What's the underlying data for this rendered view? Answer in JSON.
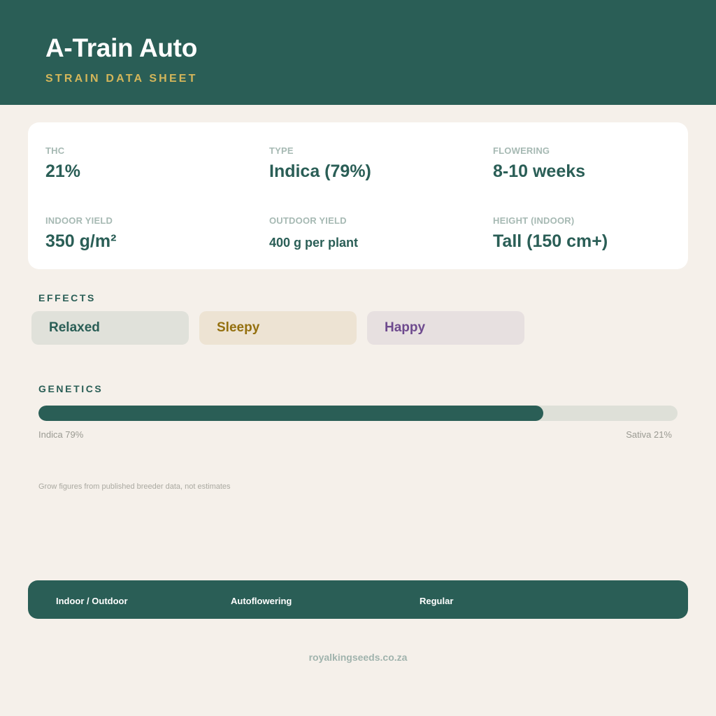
{
  "header": {
    "title": "A-Train Auto",
    "subtitle": "STRAIN DATA SHEET"
  },
  "stats": [
    {
      "label": "THC",
      "value": "21%"
    },
    {
      "label": "TYPE",
      "value": "Indica (79%)"
    },
    {
      "label": "FLOWERING",
      "value": "8-10 weeks"
    },
    {
      "label": "INDOOR YIELD",
      "value": "350 g/m²"
    },
    {
      "label": "OUTDOOR YIELD",
      "value": "400 g per plant"
    },
    {
      "label": "HEIGHT (INDOOR)",
      "value": "Tall (150 cm+)"
    }
  ],
  "effects": {
    "label": "EFFECTS",
    "items": [
      {
        "label": "Relaxed",
        "color": "#2a5e56",
        "bg": "#e0e1da"
      },
      {
        "label": "Sleepy",
        "color": "#94700f",
        "bg": "#ede3d3"
      },
      {
        "label": "Happy",
        "color": "#6e4a8e",
        "bg": "#e7e0e0"
      }
    ]
  },
  "genetics": {
    "label": "GENETICS",
    "indica_percent": 79,
    "left_caption": "Indica 79%",
    "right_caption": "Sativa 21%"
  },
  "note": "Grow figures from published breeder data, not estimates",
  "footer": {
    "items": [
      "Indoor / Outdoor",
      "Autoflowering",
      "Regular"
    ]
  },
  "site": "royalkingseeds.co.za",
  "colors": {
    "brand": "#2a5e56",
    "accent": "#d4b65a",
    "background": "#f5f0ea"
  }
}
